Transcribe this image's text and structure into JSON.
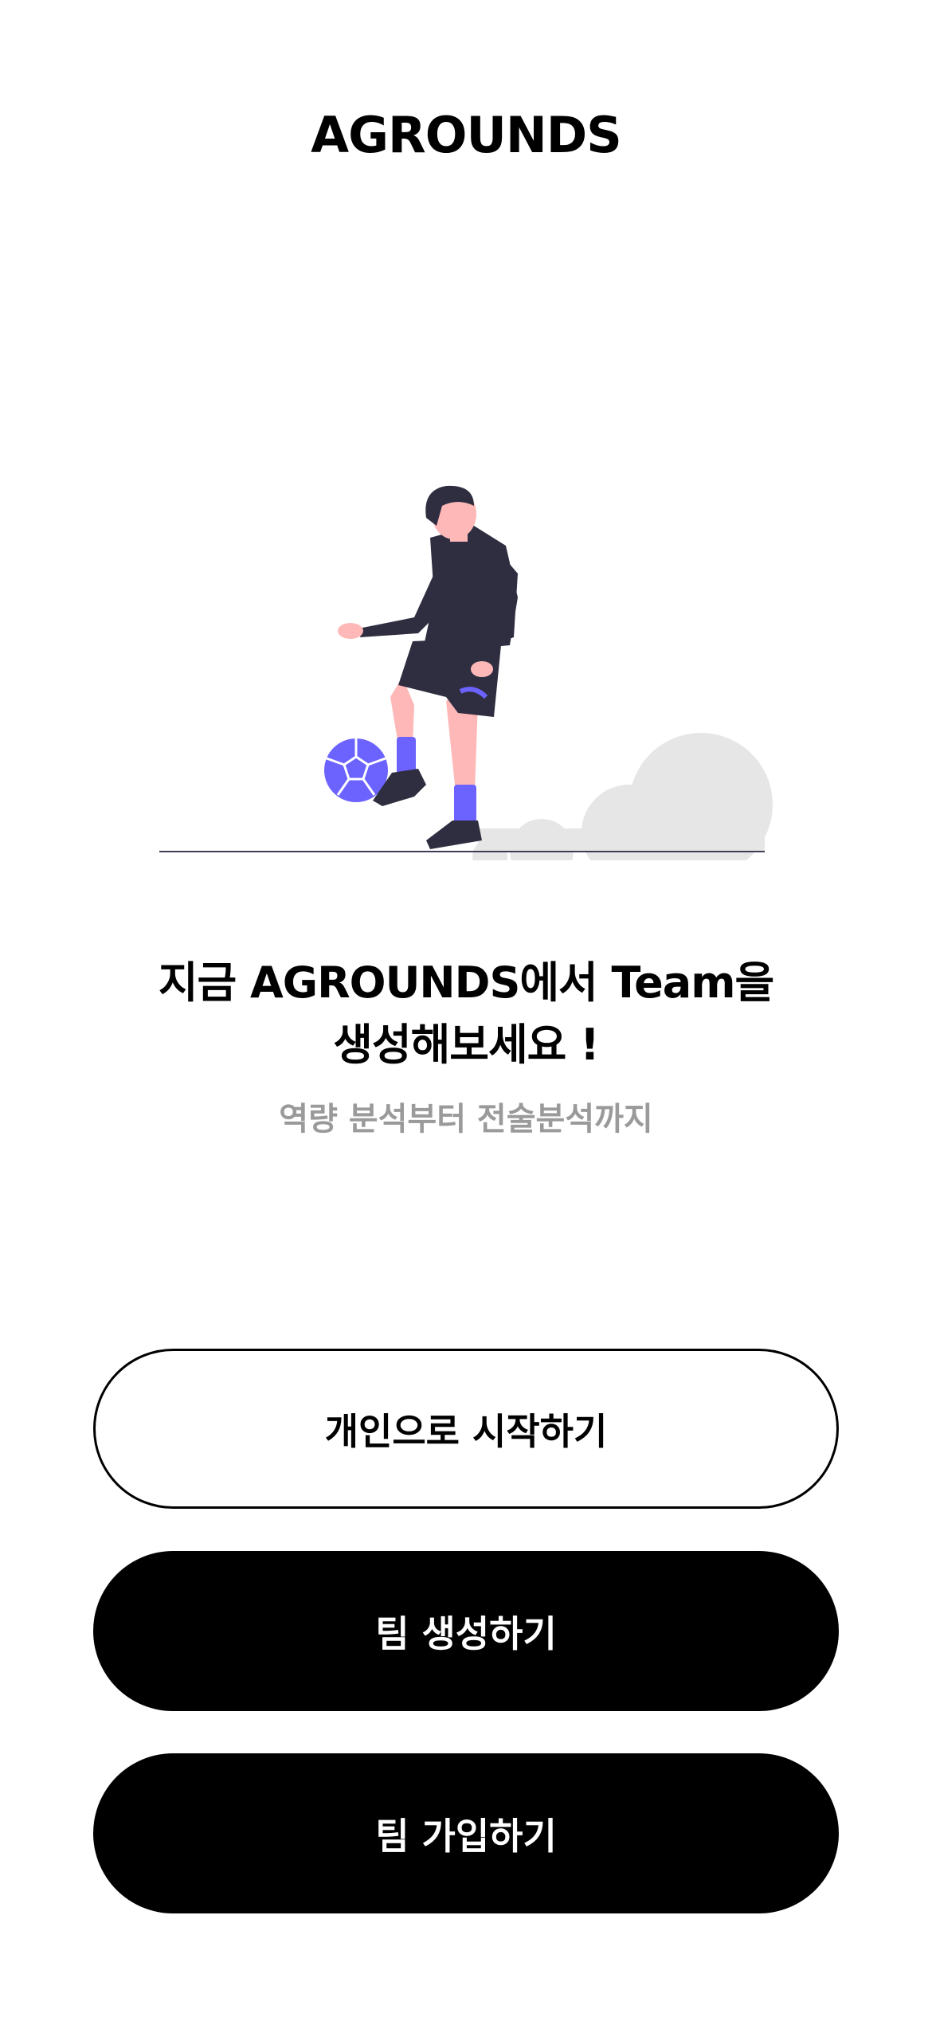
{
  "header": {
    "title": "AGROUNDS"
  },
  "hero": {
    "illustration": "soccer-player-juggling-ball",
    "colors": {
      "accent": "#6c63ff",
      "dark": "#2f2e41",
      "skin": "#ffb8b8",
      "cloud": "#e6e6e6"
    }
  },
  "intro": {
    "headline_line1": "지금 AGROUNDS에서 Team을",
    "headline_line2": "생성해보세요 !",
    "subtitle": "역량 분석부터 전술분석까지"
  },
  "actions": {
    "personal_label": "개인으로 시작하기",
    "create_team_label": "팀 생성하기",
    "join_team_label": "팀 가입하기"
  }
}
